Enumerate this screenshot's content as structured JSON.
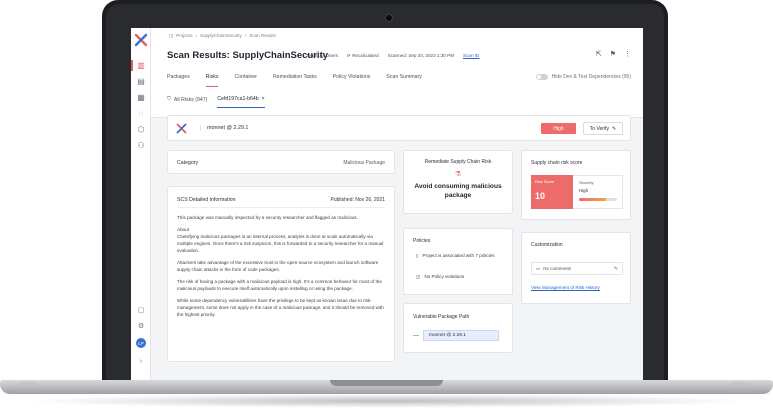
{
  "breadcrumb": [
    "Projects",
    "›",
    "SupplyChainSecurity",
    "›",
    "Scan Results"
  ],
  "page_title": "Scan Results: SupplyChainSecurity",
  "meta": {
    "team": "Team: All Users",
    "status": "Recalculated",
    "scanned": "Scanned: Sep 20, 2023 1:30 PM",
    "scan_id": "Scan ID"
  },
  "tabs": [
    "Packages",
    "Risks",
    "Container",
    "Remediation Tasks",
    "Policy Violations",
    "Scan Summary"
  ],
  "toggle_label": "Hide Dev & Test Dependencies (95)",
  "subtabs": {
    "all_risks": "All Risks (947)",
    "current": "Cefd197ca1-b64b"
  },
  "package": {
    "name": "monnet @ 2.29.1",
    "severity_badge": "High",
    "verify_label": "To Verify"
  },
  "category": {
    "label": "Category",
    "value": "Malicious Package"
  },
  "details": {
    "label": "SCS Detailed Information",
    "published": "Published: Nov 26, 2021",
    "paragraphs": [
      "This package was manually inspected by a security researcher and flagged as malicious.",
      "About",
      "Classifying malicious packages is an internal process, analysis is done at scale automatically via multiple engines. Once there's a risk suspicion, this is forwarded to a security researcher for a manual evaluation.",
      "Attackers take advantage of the excessive trust in the open-source ecosystem and launch software supply chain attacks in the form of code packages.",
      "The risk of having a package with a malicious payload is high. It's a common behavior for most of the malicious payloads to execute itself automatically upon installing or using the package.",
      "While some dependency vulnerabilities have the privilege to be kept as known issue due to risk-management, some does not apply in the case of a malicious package, and it should be removed with the highest priority."
    ]
  },
  "mitigation": {
    "title": "Remediate Supply Chain Risk",
    "message": "Avoid consuming malicious package"
  },
  "risk_score": {
    "title": "Supply chain risk score",
    "score_label": "Risk Score",
    "score": "10",
    "severity_label": "Severity",
    "severity_value": "High",
    "severity_level": 0.7
  },
  "policies": {
    "title": "Policies",
    "items": [
      "Project is associated with 7 policies",
      "No Policy violations"
    ]
  },
  "customization": {
    "title": "Customization",
    "comments": "No comments",
    "history_link": "View Management of Risk History"
  },
  "vulnerable_path": {
    "title": "Vulnerable Package Path",
    "node": "monnet @ 2.29.1"
  },
  "avatar_initials": "LP",
  "colors": {
    "accent": "#e45f5f",
    "link": "#2d5fcf",
    "badge_high": "#ee6b6b"
  }
}
